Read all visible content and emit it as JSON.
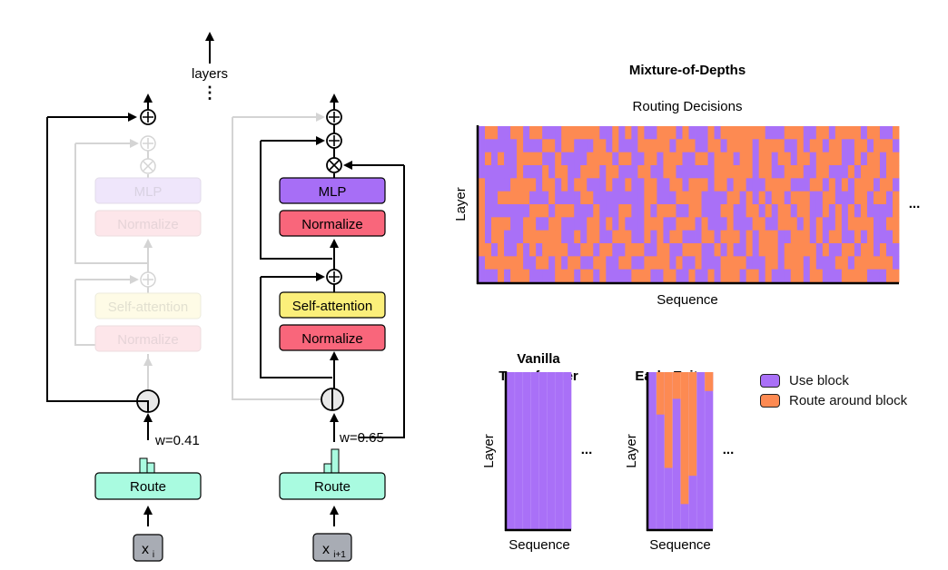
{
  "diagram": {
    "layers_label": "layers",
    "vdots": "⋮",
    "left_block": {
      "state": "skipped",
      "mlp_label": "MLP",
      "normalize_top_label": "Normalize",
      "self_attention_label": "Self-attention",
      "normalize_bottom_label": "Normalize",
      "route_label": "Route",
      "weight_label": "w=0.41",
      "input_label": "x",
      "input_subscript": "i"
    },
    "right_block": {
      "state": "processed",
      "mlp_label": "MLP",
      "normalize_top_label": "Normalize",
      "self_attention_label": "Self-attention",
      "normalize_bottom_label": "Normalize",
      "route_label": "Route",
      "weight_label": "w=0.65",
      "input_label": "x",
      "input_subscript": "i+1"
    },
    "colors": {
      "mlp": "#a76ef6",
      "normalize": "#f9667b",
      "self_attention": "#fbef7a",
      "route": "#a9fbe0",
      "input": "#a8acb4",
      "faded_mlp": "#efe6fb",
      "faded_normalize": "#fde6ea",
      "faded_self_attention": "#fefbe6"
    }
  },
  "chart_data": [
    {
      "type": "heatmap",
      "title": "Mixture-of-Depths",
      "subtitle": "Routing Decisions",
      "xlabel": "Sequence",
      "ylabel": "Layer",
      "continuation": "...",
      "legend": [
        {
          "label": "Use block",
          "color": "#a970f7",
          "value": 0
        },
        {
          "label": "Route around block",
          "color": "#fd8a52",
          "value": 1
        }
      ],
      "rows": [
        "011001101100011111100101010011101000101111111000111001101111011001",
        "000000100011011000110100011111011100110111101111001011011001101110",
        "010100111100100001111011001101110011011101101101101101111001011011",
        "000000100010110011101100011001100000011111101100111001100010111011",
        "100001111011010110001001001100110111011011000111100011010101110110",
        "100111110001000011000000001100011110000110101011011100110001101101",
        "100000001110111000100011001011100110001100110101101100101010100001",
        "101110011001100001101010001110011101000100011001110101001011110011",
        "101100011111100101100111001010110001101110101110011101011001010001",
        "110100101011110011011001110011001110010100101110111110100110110100",
        "011111100110101100110011001111010010001111000110111010001101111110",
        "000101110000111011010000111001100100101110110100011011000111100011"
      ]
    },
    {
      "type": "heatmap",
      "title": "Vanilla Transformer",
      "xlabel": "Sequence",
      "ylabel": "Layer",
      "continuation": "...",
      "columns": 8,
      "route_around_fraction_from_top": [
        0,
        0,
        0,
        0,
        0,
        0,
        0,
        0
      ]
    },
    {
      "type": "heatmap",
      "title": "Early-Exit",
      "xlabel": "Sequence",
      "ylabel": "Layer",
      "continuation": "...",
      "columns": 8,
      "route_around_fraction_from_top": [
        0,
        0.27,
        0.61,
        0.17,
        0.84,
        0.66,
        0,
        0.12
      ]
    }
  ]
}
